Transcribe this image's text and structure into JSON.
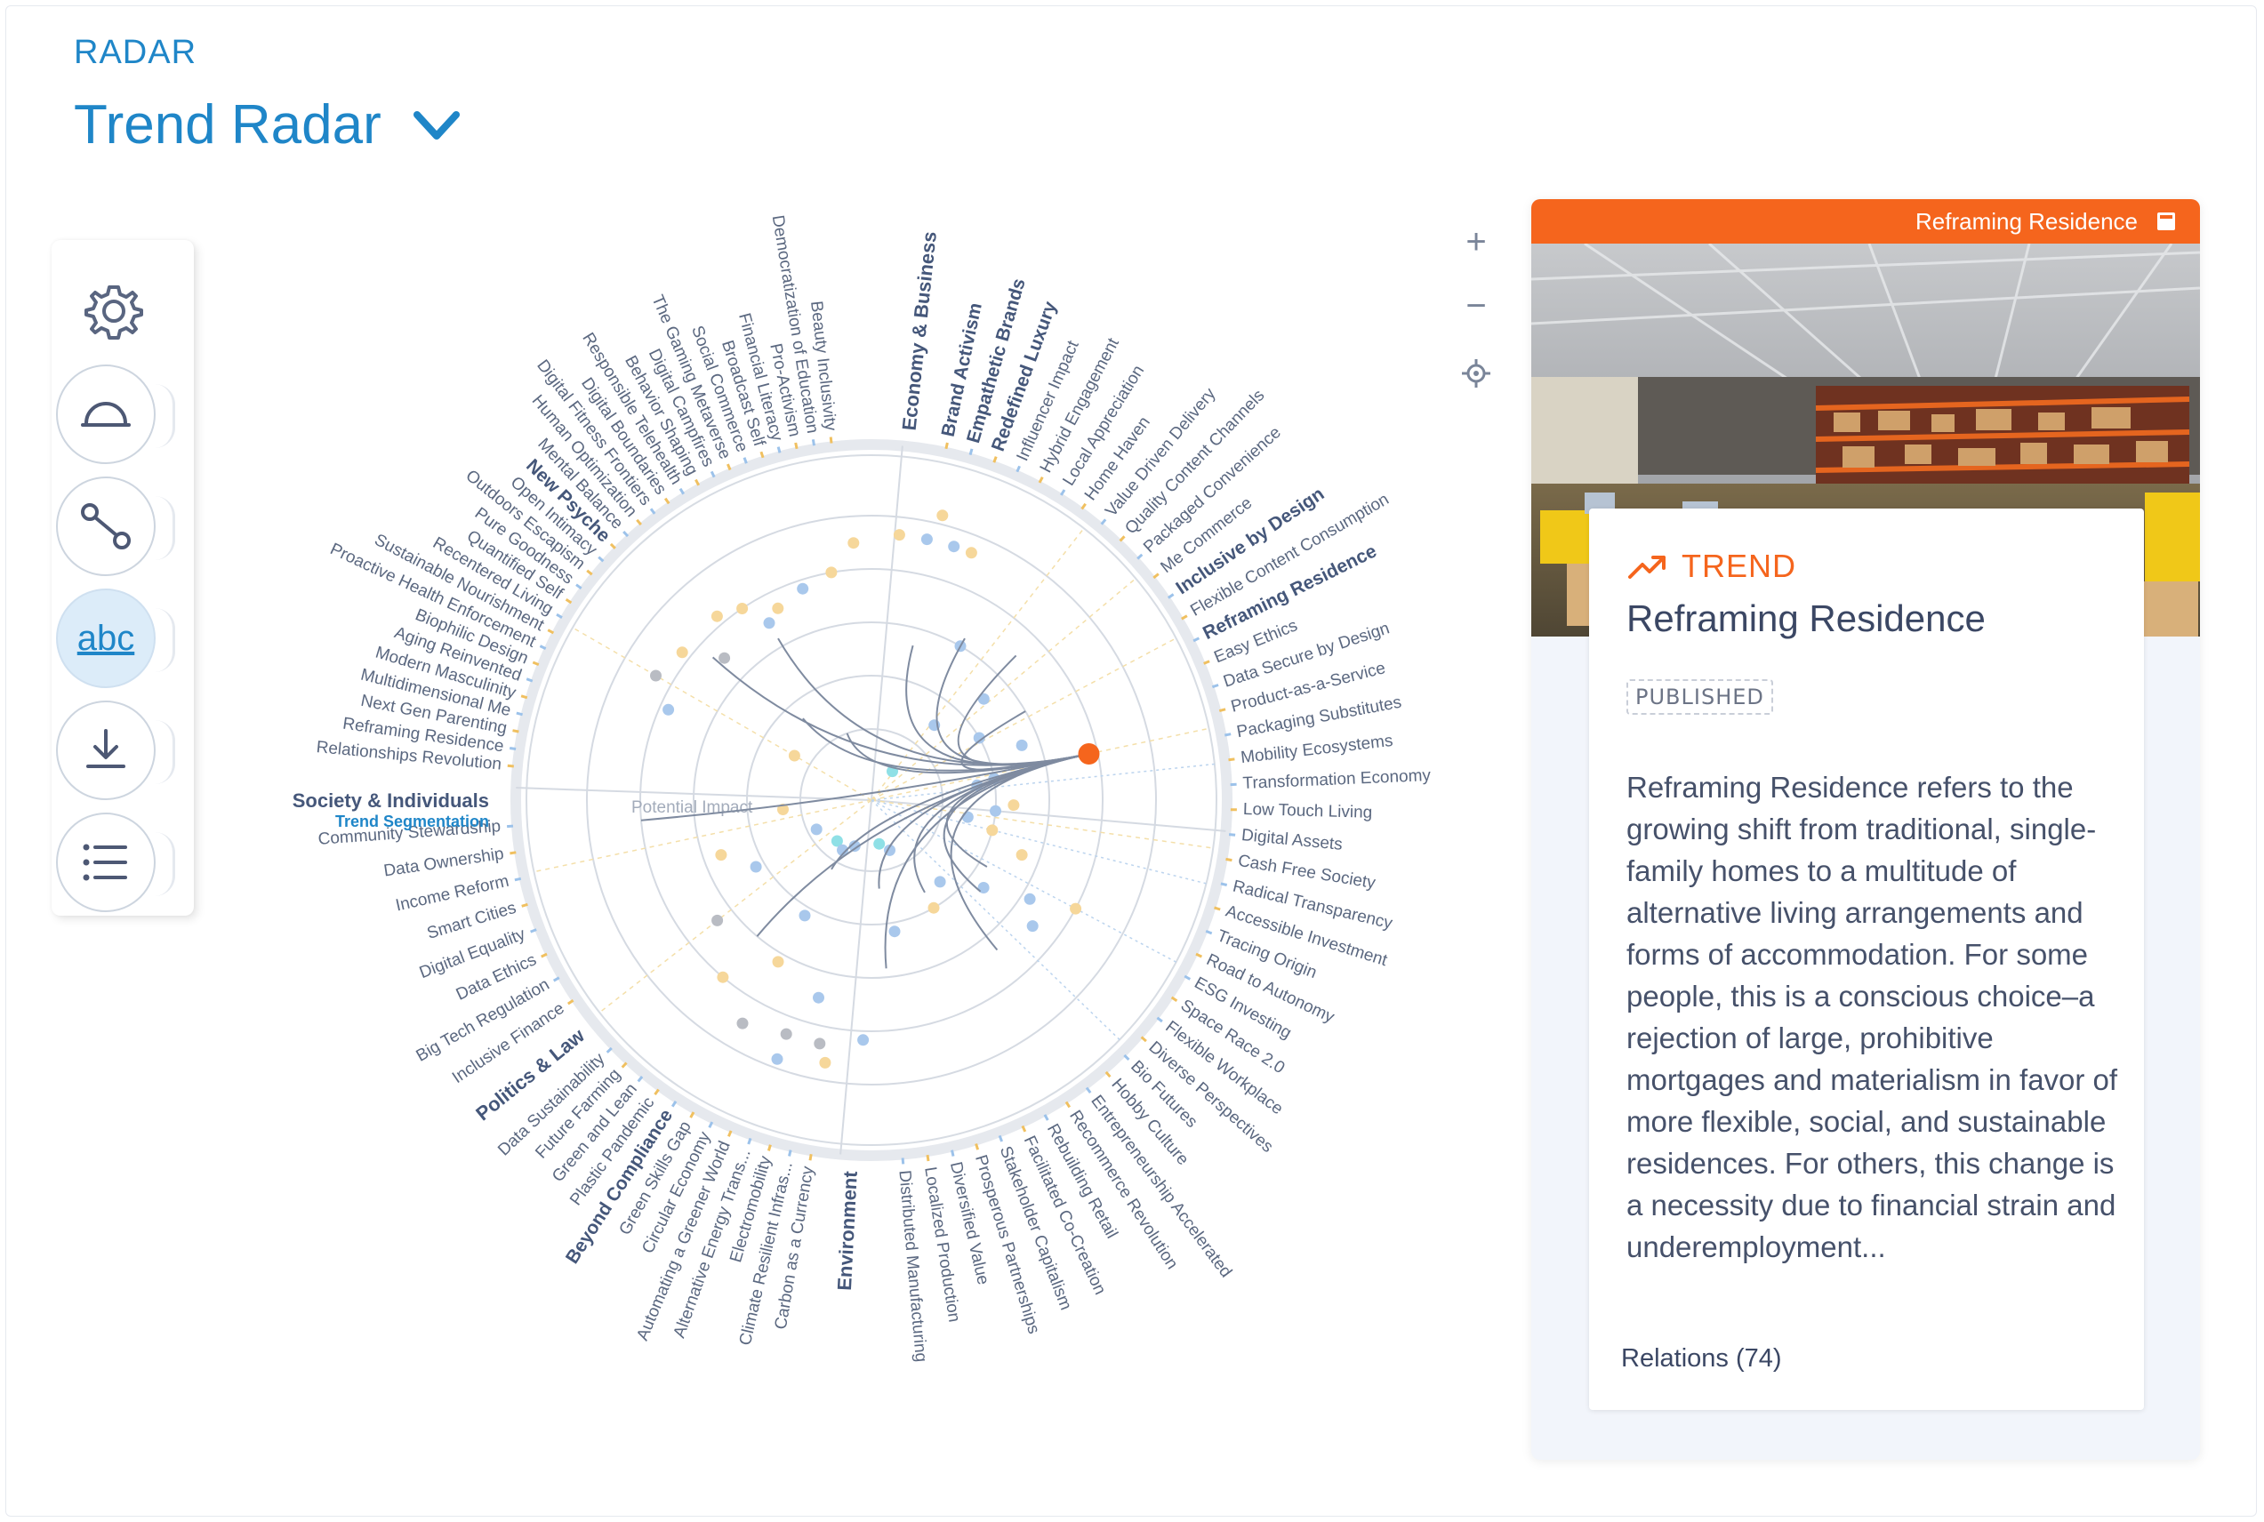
{
  "header": {
    "kicker": "RADAR",
    "title": "Trend Radar"
  },
  "toolbar": {
    "tools": [
      {
        "name": "gear-icon"
      },
      {
        "name": "segments-icon"
      },
      {
        "name": "relations-icon"
      },
      {
        "name": "labels-toggle",
        "label": "abc",
        "active": true
      },
      {
        "name": "download-icon"
      },
      {
        "name": "list-icon"
      }
    ]
  },
  "zoom": {
    "zoom_in": "+",
    "zoom_out": "−"
  },
  "colors": {
    "accent_blue": "#1f86c8",
    "selected_orange": "#f5651d",
    "dot_blue": "#a9c8ec",
    "dot_yellow": "#f6d79a",
    "dot_gray": "#b9bcc3",
    "dot_teal": "#8fe0e6"
  },
  "radar": {
    "axis_label": "Potential Impact",
    "sectors": [
      {
        "name": "Economy & Business",
        "categories": [
          "Brand Activism",
          "Empathetic Brands",
          "Redefined Luxury",
          "Inclusive by Design",
          "Reframing Residence"
        ],
        "trends": [
          "Brand Activism",
          "Empathetic Brands",
          "Redefined Luxury",
          "Influencer Impact",
          "Hybrid Engagement",
          "Local Appreciation",
          "Home Haven",
          "Value Driven Delivery",
          "Quality Content Channels",
          "Packaged Convenience",
          "Me Commerce",
          "Inclusive by Design",
          "Flexible Content Consumption",
          "Reframing Residence",
          "Easy Ethics",
          "Data Secure by Design",
          "Product-as-a-Service",
          "Packaging Substitutes",
          "Mobility Ecosystems",
          "Transformation Economy",
          "Low Touch Living",
          "Digital Assets",
          "Cash Free Society",
          "Radical Transparency",
          "Accessible Investment",
          "Tracing Origin",
          "Road to Autonomy",
          "ESG Investing",
          "Space Race 2.0",
          "Flexible Workplace",
          "Diverse Perspectives",
          "Bio Futures",
          "Hobby Culture",
          "Entrepreneurship Accelerated",
          "Recommerce Revolution",
          "Rebuilding Retail",
          "Facilitated Co-Creation",
          "Stakeholder Capitalism",
          "Prosperous Partnerships",
          "Diversified Value",
          "Localized Production",
          "Distributed Manufacturing"
        ]
      },
      {
        "name": "Environment",
        "categories": [
          "Beyond Compliance"
        ],
        "trends": [
          "Carbon as a Currency",
          "Climate Resilient Infras...",
          "Electromobility",
          "Alternative Energy Trans...",
          "Automating a Greener World",
          "Circular Economy",
          "Green Skills Gap",
          "Beyond Compliance",
          "Plastic Pandemic",
          "Green and Lean",
          "Future Farming",
          "Data Sustainability"
        ]
      },
      {
        "name": "Politics & Law",
        "categories": [],
        "trends": [
          "Inclusive Finance",
          "Big Tech Regulation",
          "Data Ethics",
          "Digital Equality",
          "Smart Cities",
          "Income Reform",
          "Data Ownership",
          "Community Stewardship"
        ]
      },
      {
        "name": "Society & Individuals",
        "sub_label": "Trend Segmentation",
        "categories": [
          "New Psyche"
        ],
        "trends": [
          "Relationships Revolution",
          "Reframing Residence",
          "Next Gen Parenting",
          "Multidimensional Me",
          "Modern Masculinity",
          "Aging Reinvented",
          "Biophilic Design",
          "Proactive Health Enforcement",
          "Sustainable Nourishment",
          "Recentered Living",
          "Quantified Self",
          "Pure Goodness",
          "Outdoors Escapism",
          "Open Intimacy",
          "New Psyche",
          "Mental Balance",
          "Human Optimization",
          "Digital Fitness Frontiers",
          "Digital Boundaries",
          "Responsible Telehealth",
          "Behavior Shaping",
          "Digital Campfires",
          "The Gaming Metaverse",
          "Social Commerce",
          "Broadcast Self",
          "Financial Literacy",
          "Pro-Activism",
          "Democratization of Education",
          "Beauty Inclusivity"
        ]
      }
    ],
    "selected_trend": "Reframing Residence"
  },
  "detail": {
    "header_title": "Reframing Residence",
    "type": "TREND",
    "name": "Reframing Residence",
    "status": "PUBLISHED",
    "description": "Reframing Residence refers to the growing shift from traditional, single-family homes to a multitude of alternative living arrangements and forms of accommodation. For some people, this is a conscious choice–a rejection of large, prohibitive mortgages and materialism in favor of more flexible, social, and sustainable residences. For others, this change is a necessity due to financial strain and underemployment...",
    "relations": "Relations (74)"
  }
}
